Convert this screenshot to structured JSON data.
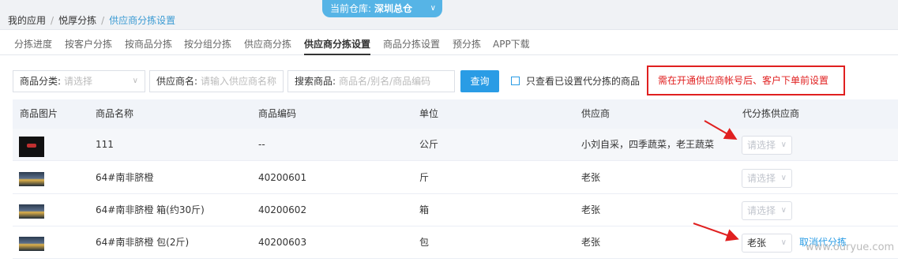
{
  "breadcrumb": {
    "item1": "我的应用",
    "item2": "悦厚分拣",
    "current": "供应商分拣设置"
  },
  "warehouse": {
    "label": "当前仓库:",
    "value": "深圳总仓"
  },
  "tabs": [
    {
      "label": "分拣进度"
    },
    {
      "label": "按客户分拣"
    },
    {
      "label": "按商品分拣"
    },
    {
      "label": "按分组分拣"
    },
    {
      "label": "供应商分拣"
    },
    {
      "label": "供应商分拣设置"
    },
    {
      "label": "商品分拣设置"
    },
    {
      "label": "预分拣"
    },
    {
      "label": "APP下载"
    }
  ],
  "filters": {
    "category_label": "商品分类:",
    "category_placeholder": "请选择",
    "supplier_label": "供应商名:",
    "supplier_placeholder": "请输入供应商名称",
    "search_label": "搜索商品:",
    "search_placeholder": "商品名/别名/商品编码",
    "query_button": "查询",
    "only_set_label": "只查看已设置代分拣的商品"
  },
  "notice": "需在开通供应商帐号后、客户下单前设置",
  "table": {
    "headers": [
      "商品图片",
      "商品名称",
      "商品编码",
      "单位",
      "供应商",
      "代分拣供应商"
    ],
    "rows": [
      {
        "name": "111",
        "code": "--",
        "unit": "公斤",
        "supplier": "小刘自采，四季蔬菜，老王蔬菜",
        "agent": "请选择",
        "agent_set": false,
        "action": ""
      },
      {
        "name": "64#南非脐橙",
        "code": "40200601",
        "unit": "斤",
        "supplier": "老张",
        "agent": "请选择",
        "agent_set": false,
        "action": ""
      },
      {
        "name": "64#南非脐橙 箱(约30斤)",
        "code": "40200602",
        "unit": "箱",
        "supplier": "老张",
        "agent": "请选择",
        "agent_set": false,
        "action": ""
      },
      {
        "name": "64#南非脐橙 包(2斤)",
        "code": "40200603",
        "unit": "包",
        "supplier": "老张",
        "agent": "老张",
        "agent_set": true,
        "action": "取消代分拣"
      }
    ]
  },
  "watermark": "www.ouryue.com",
  "colors": {
    "accent": "#2a9ce5",
    "notice_red": "#e02020",
    "header_bg": "#f0f2f5"
  }
}
